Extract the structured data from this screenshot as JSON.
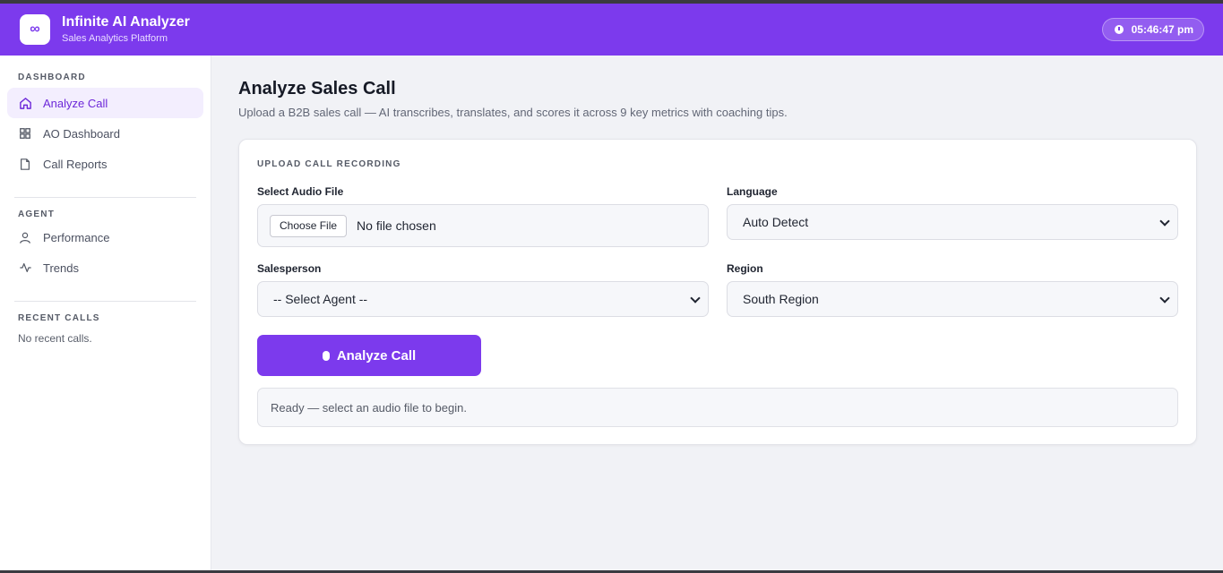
{
  "app": {
    "logo_glyph": "∞",
    "title": "Infinite AI Analyzer",
    "subtitle": "Sales Analytics Platform",
    "clock": "05:46:47 pm",
    "brand_color": "#7c3aed"
  },
  "sidebar": {
    "dashboard_label": "DASHBOARD",
    "dashboard_items": [
      {
        "label": "Analyze Call",
        "icon": "home-icon",
        "active": true
      },
      {
        "label": "AO Dashboard",
        "icon": "grid-icon",
        "active": false
      },
      {
        "label": "Call Reports",
        "icon": "document-icon",
        "active": false
      }
    ],
    "agent_label": "AGENT",
    "agent_items": [
      {
        "label": "Performance",
        "icon": "user-icon"
      },
      {
        "label": "Trends",
        "icon": "activity-icon"
      }
    ],
    "recent_label": "RECENT CALLS",
    "recent_empty": "No recent calls."
  },
  "main": {
    "title": "Analyze Sales Call",
    "subtitle": "Upload a B2B sales call — AI transcribes, translates, and scores it across 9 key metrics with coaching tips."
  },
  "form": {
    "card_label": "UPLOAD CALL RECORDING",
    "audio_label": "Select Audio File",
    "file_button": "Choose File",
    "file_status": "No file chosen",
    "language_label": "Language",
    "language_value": "Auto Detect",
    "salesperson_label": "Salesperson",
    "salesperson_value": "-- Select Agent --",
    "region_label": "Region",
    "region_value": "South Region",
    "analyze_button": "Analyze Call",
    "status": "Ready — select an audio file to begin."
  }
}
